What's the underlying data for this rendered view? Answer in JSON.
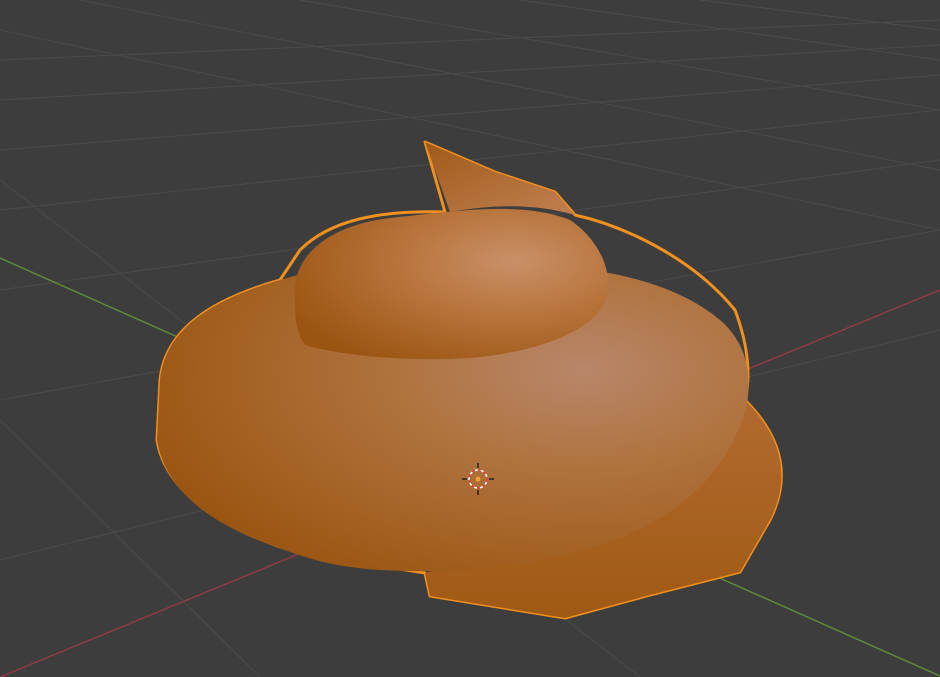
{
  "viewport": {
    "background": "#3d3d3d",
    "grid_color": "#4a4a4a",
    "x_axis_color": "#8f3a45",
    "y_axis_color": "#5f8a3a"
  },
  "scene": {
    "selected_object": "coiled-mesh",
    "object_color": "#c47a3a",
    "outline_color": "#f0901e",
    "origin_marker": "3d-cursor"
  }
}
